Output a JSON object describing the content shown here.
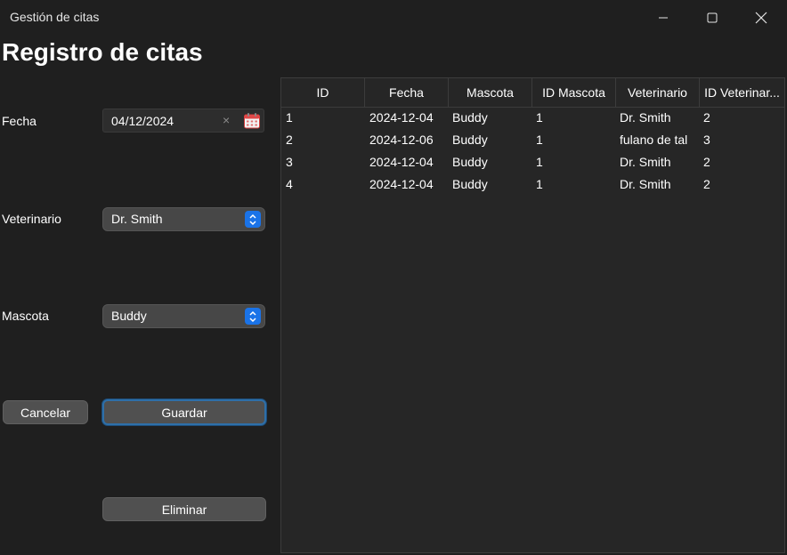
{
  "window": {
    "title": "Gestión de citas"
  },
  "heading": "Registro de citas",
  "form": {
    "fecha_label": "Fecha",
    "fecha_value": "04/12/2024",
    "clear_glyph": "×",
    "veterinario_label": "Veterinario",
    "veterinario_value": "Dr. Smith",
    "mascota_label": "Mascota",
    "mascota_value": "Buddy"
  },
  "buttons": {
    "cancel": "Cancelar",
    "save": "Guardar",
    "delete": "Eliminar"
  },
  "table": {
    "columns": [
      "ID",
      "Fecha",
      "Mascota",
      "ID Mascota",
      "Veterinario",
      "ID Veterinar..."
    ],
    "rows": [
      [
        "1",
        "2024-12-04",
        "Buddy",
        "1",
        "Dr. Smith",
        "2"
      ],
      [
        "2",
        "2024-12-06",
        "Buddy",
        "1",
        "fulano de tal",
        "3"
      ],
      [
        "3",
        "2024-12-04",
        "Buddy",
        "1",
        "Dr. Smith",
        "2"
      ],
      [
        "4",
        "2024-12-04",
        "Buddy",
        "1",
        "Dr. Smith",
        "2"
      ]
    ]
  },
  "colors": {
    "background": "#1f1f1f",
    "accent": "#1a73e8",
    "calendar_icon": "#e04848",
    "focus_border": "#2e6fa8"
  }
}
